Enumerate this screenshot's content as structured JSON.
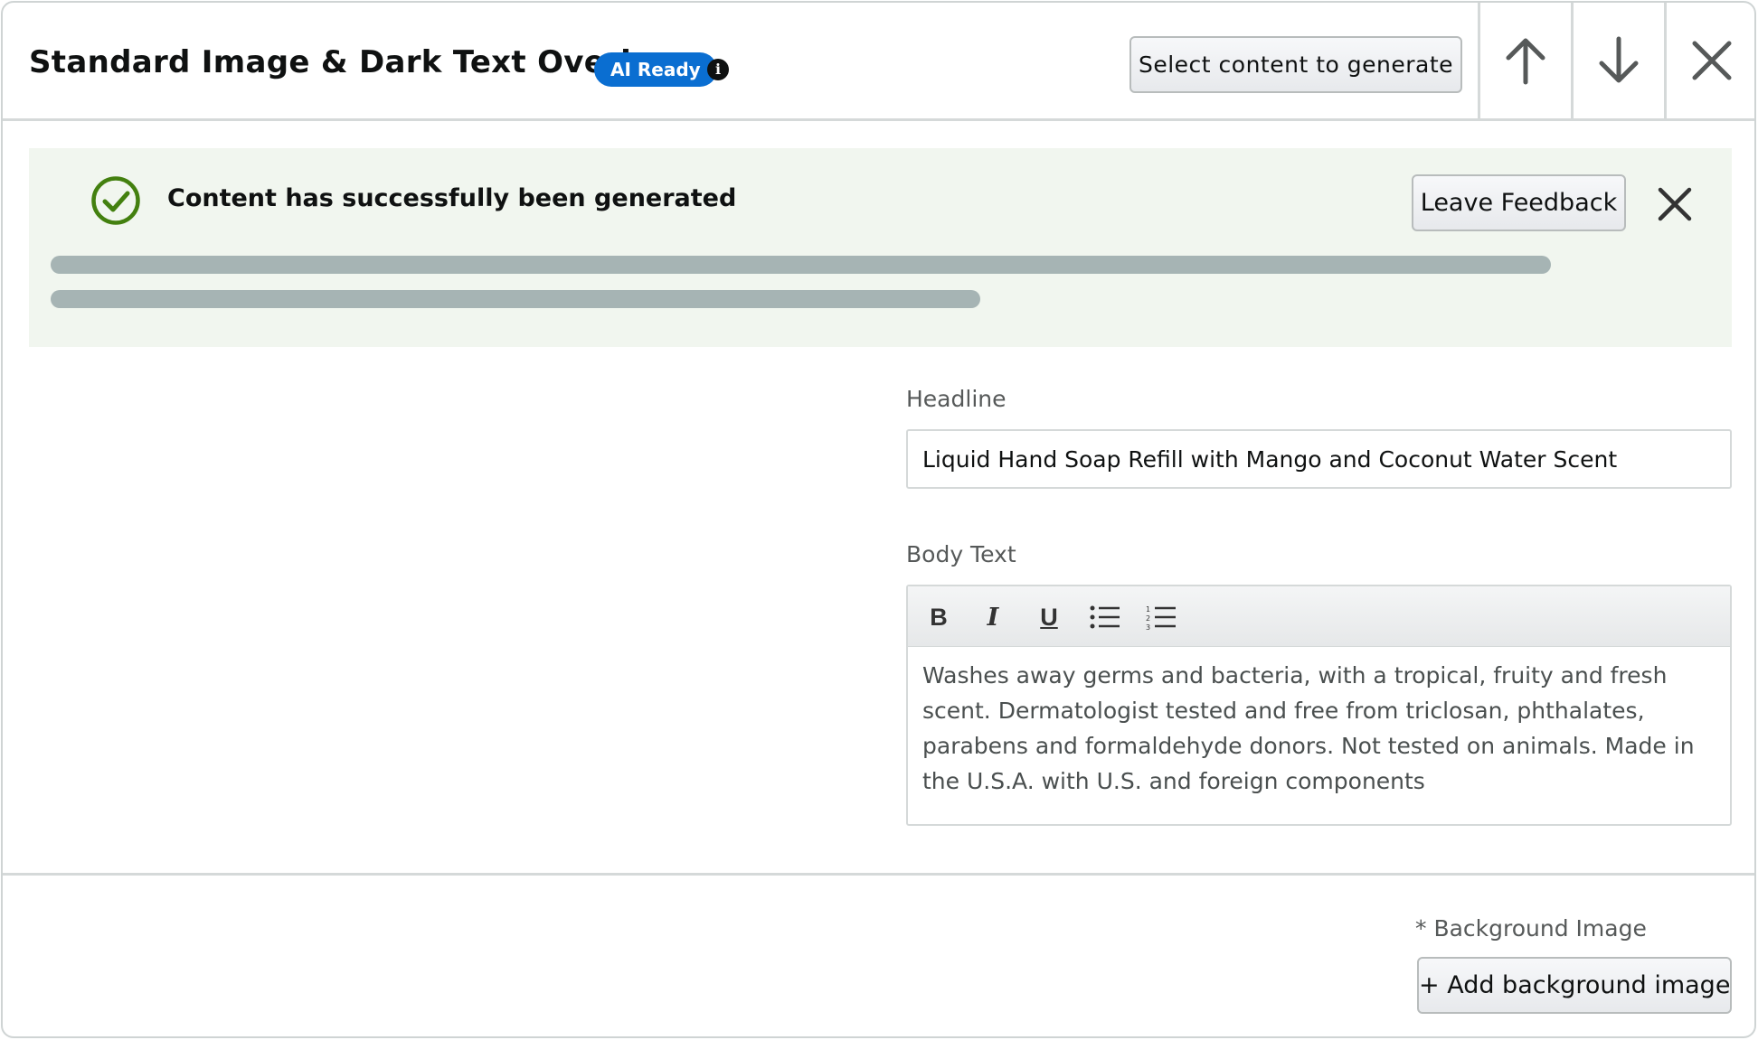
{
  "header": {
    "title": "Standard Image & Dark Text Overlay",
    "badge": "AI Ready",
    "info_glyph": "i",
    "select_button_label": "Select content to generate",
    "move_up_icon": "arrow-up-icon",
    "move_down_icon": "arrow-down-icon",
    "close_icon": "close-icon"
  },
  "alert": {
    "message": "Content has successfully been generated",
    "feedback_label": "Leave Feedback",
    "status_icon": "check-circle-icon",
    "dismiss_icon": "close-icon",
    "accent_color": "#43800f",
    "background_color": "#f1f6ef"
  },
  "form": {
    "headline_label": "Headline",
    "headline_value": "Liquid Hand Soap Refill with Mango and Coconut Water Scent",
    "body_label": "Body Text",
    "toolbar": {
      "bold_label": "B",
      "italic_label": "I",
      "underline_label": "U",
      "bullet_list_icon": "bulleted-list-icon",
      "numbered_list_icon": "numbered-list-icon"
    },
    "body_value": "Washes away germs and bacteria, with a tropical, fruity and fresh scent. Dermatologist tested and free from triclosan, phthalates, parabens and formaldehyde donors. Not tested on animals. Made in the U.S.A. with U.S. and foreign components",
    "background_label": "* Background Image",
    "add_background_label": "+ Add background image"
  },
  "colors": {
    "badge_blue": "#0a6ed1",
    "skeleton_bar": "#a6b4b4",
    "border": "#d5d9d9"
  }
}
